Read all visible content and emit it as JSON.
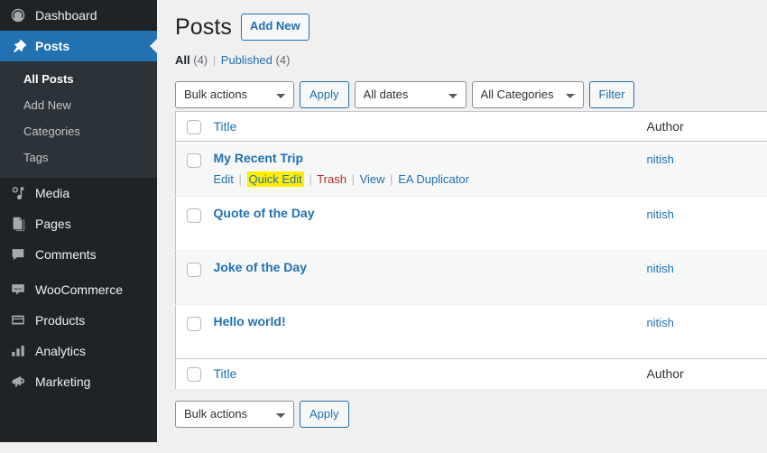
{
  "sidebar": {
    "items": [
      {
        "label": "Dashboard",
        "icon": "dashboard-icon",
        "current": false
      },
      {
        "label": "Posts",
        "icon": "pin-icon",
        "current": true
      },
      {
        "label": "Media",
        "icon": "media-icon",
        "current": false
      },
      {
        "label": "Pages",
        "icon": "pages-icon",
        "current": false
      },
      {
        "label": "Comments",
        "icon": "comments-icon",
        "current": false
      },
      {
        "label": "WooCommerce",
        "icon": "woocommerce-icon",
        "current": false
      },
      {
        "label": "Products",
        "icon": "products-icon",
        "current": false
      },
      {
        "label": "Analytics",
        "icon": "analytics-icon",
        "current": false
      },
      {
        "label": "Marketing",
        "icon": "marketing-icon",
        "current": false
      }
    ],
    "submenu": [
      {
        "label": "All Posts",
        "current": true
      },
      {
        "label": "Add New",
        "current": false
      },
      {
        "label": "Categories",
        "current": false
      },
      {
        "label": "Tags",
        "current": false
      }
    ]
  },
  "header": {
    "title": "Posts",
    "add_new_label": "Add New"
  },
  "views": {
    "all_label": "All",
    "all_count": "(4)",
    "divider": "|",
    "published_label": "Published",
    "published_count": "(4)"
  },
  "toolbar_top": {
    "bulk_actions_value": "Bulk actions",
    "apply_label": "Apply",
    "dates_value": "All dates",
    "categories_value": "All Categories",
    "filter_label": "Filter"
  },
  "toolbar_bottom": {
    "bulk_actions_value": "Bulk actions",
    "apply_label": "Apply"
  },
  "table": {
    "columns": {
      "title": "Title",
      "author": "Author"
    },
    "rows": [
      {
        "title": "My Recent Trip",
        "author": "nitish",
        "actions": [
          {
            "label": "Edit",
            "style": "normal"
          },
          {
            "label": "Quick Edit",
            "style": "highlight"
          },
          {
            "label": "Trash",
            "style": "trash"
          },
          {
            "label": "View",
            "style": "normal"
          },
          {
            "label": "EA Duplicator",
            "style": "normal"
          }
        ]
      },
      {
        "title": "Quote of the Day",
        "author": "nitish",
        "actions": []
      },
      {
        "title": "Joke of the Day",
        "author": "nitish",
        "actions": []
      },
      {
        "title": "Hello world!",
        "author": "nitish",
        "actions": []
      }
    ]
  },
  "colors": {
    "sidebar_bg": "#1d2327",
    "submenu_bg": "#2c3338",
    "accent_blue": "#2271b1",
    "link_blue": "#2271b1",
    "trash_red": "#b32d2e",
    "highlight_yellow": "#ffee00",
    "content_bg": "#f0f0f1",
    "row_alt_bg": "#f6f7f7"
  }
}
